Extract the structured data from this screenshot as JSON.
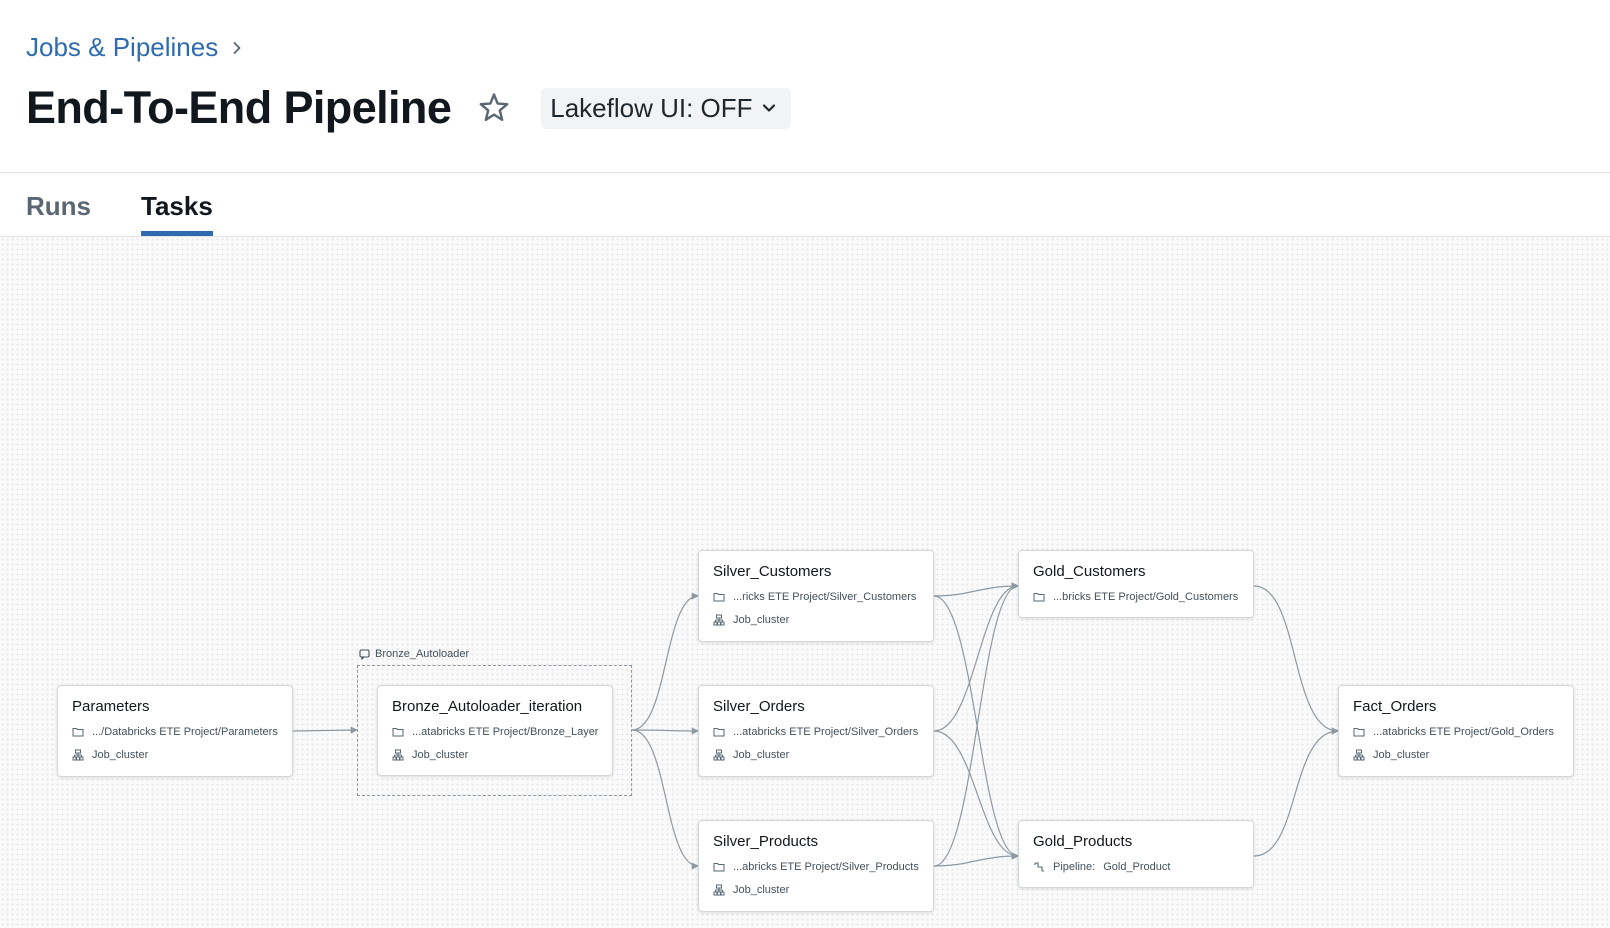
{
  "breadcrumb": {
    "label": "Jobs & Pipelines",
    "chevron_icon": "chevron-right-icon"
  },
  "header": {
    "title": "End-To-End Pipeline",
    "favorite_icon": "star-icon",
    "ui_toggle_label": "Lakeflow UI: OFF",
    "ui_toggle_icon": "chevron-down-icon"
  },
  "tabs": [
    {
      "label": "Runs",
      "active": false
    },
    {
      "label": "Tasks",
      "active": true
    }
  ],
  "colors": {
    "accent": "#2f6bb1",
    "edge": "#8f99a2",
    "node_border": "#d3d8dc",
    "canvas_bg": "#fafafa"
  },
  "group": {
    "label": "Bronze_Autoloader",
    "icon": "for-each-icon"
  },
  "tasks": [
    {
      "id": "parameters",
      "name": "Parameters",
      "path": ".../Databricks ETE Project/Parameters",
      "path_icon": "folder-icon",
      "cluster": "Job_cluster",
      "cluster_icon": "cluster-icon"
    },
    {
      "id": "bronze",
      "name": "Bronze_Autoloader_iteration",
      "path": "...atabricks ETE Project/Bronze_Layer",
      "path_icon": "folder-icon",
      "cluster": "Job_cluster",
      "cluster_icon": "cluster-icon"
    },
    {
      "id": "silver_customers",
      "name": "Silver_Customers",
      "path": "...ricks ETE Project/Silver_Customers",
      "path_icon": "folder-icon",
      "cluster": "Job_cluster",
      "cluster_icon": "cluster-icon"
    },
    {
      "id": "silver_orders",
      "name": "Silver_Orders",
      "path": "...atabricks ETE Project/Silver_Orders",
      "path_icon": "folder-icon",
      "cluster": "Job_cluster",
      "cluster_icon": "cluster-icon"
    },
    {
      "id": "silver_products",
      "name": "Silver_Products",
      "path": "...abricks ETE Project/Silver_Products",
      "path_icon": "folder-icon",
      "cluster": "Job_cluster",
      "cluster_icon": "cluster-icon"
    },
    {
      "id": "gold_customers",
      "name": "Gold_Customers",
      "path": "...bricks ETE Project/Gold_Customers",
      "path_icon": "folder-icon"
    },
    {
      "id": "gold_products",
      "name": "Gold_Products",
      "pipeline_label": "Pipeline:",
      "pipeline": "Gold_Product",
      "pipeline_icon": "pipeline-icon"
    },
    {
      "id": "fact_orders",
      "name": "Fact_Orders",
      "path": "...atabricks ETE Project/Gold_Orders",
      "path_icon": "folder-icon",
      "cluster": "Job_cluster",
      "cluster_icon": "cluster-icon"
    }
  ],
  "dependencies": [
    [
      "parameters",
      "bronze"
    ],
    [
      "bronze",
      "silver_customers"
    ],
    [
      "bronze",
      "silver_orders"
    ],
    [
      "bronze",
      "silver_products"
    ],
    [
      "silver_customers",
      "gold_customers"
    ],
    [
      "silver_orders",
      "gold_customers"
    ],
    [
      "silver_products",
      "gold_customers"
    ],
    [
      "silver_customers",
      "gold_products"
    ],
    [
      "silver_orders",
      "gold_products"
    ],
    [
      "silver_products",
      "gold_products"
    ],
    [
      "gold_customers",
      "fact_orders"
    ],
    [
      "gold_products",
      "fact_orders"
    ]
  ]
}
